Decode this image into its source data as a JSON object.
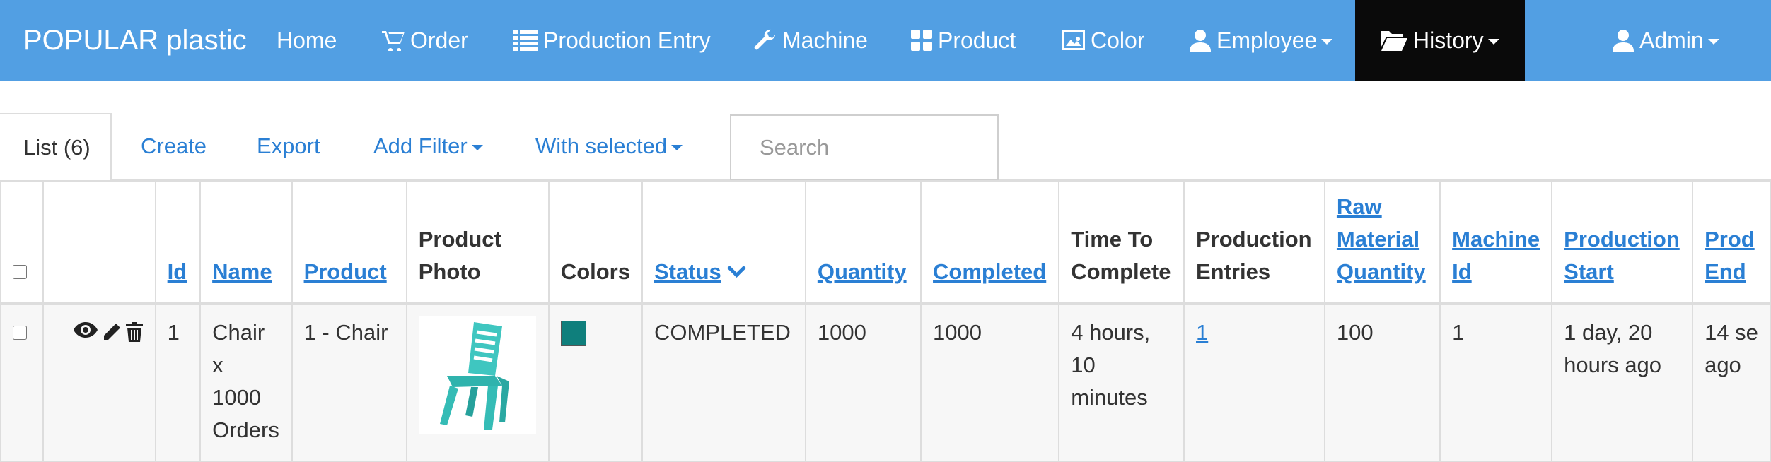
{
  "navbar": {
    "brand": "POPULAR plastic",
    "items": [
      {
        "label": "Home",
        "icon": ""
      },
      {
        "label": "Order",
        "icon": "cart-icon"
      },
      {
        "label": "Production Entry",
        "icon": "list-icon"
      },
      {
        "label": "Machine",
        "icon": "wrench-icon"
      },
      {
        "label": "Product",
        "icon": "grid-icon"
      },
      {
        "label": "Color",
        "icon": "picture-icon"
      },
      {
        "label": "Employee",
        "icon": "user-icon"
      },
      {
        "label": "History",
        "icon": "folder-open-icon"
      },
      {
        "label": "Admin",
        "icon": "user-icon"
      }
    ],
    "active_item": "History",
    "colors": {
      "bar": "#529fe3",
      "active": "#0a0a0a"
    }
  },
  "toolbar": {
    "list_label": "List (6)",
    "create_label": "Create",
    "export_label": "Export",
    "add_filter_label": "Add Filter",
    "with_selected_label": "With selected",
    "search_placeholder": "Search"
  },
  "table": {
    "headers": {
      "id": "Id",
      "name": "Name",
      "product": "Product",
      "product_photo": [
        "Product",
        "Photo"
      ],
      "colors": "Colors",
      "status": "Status",
      "quantity": "Quantity",
      "completed": "Completed",
      "time_to_complete": [
        "Time To",
        "Complete"
      ],
      "production_entries": [
        "Production",
        "Entries"
      ],
      "raw_material_quantity": [
        "Raw",
        "Material",
        "Quantity"
      ],
      "machine_id": [
        "Machine",
        "Id"
      ],
      "production_start": [
        "Production",
        "Start"
      ],
      "production_end": [
        "Prod",
        "End"
      ]
    },
    "rows": [
      {
        "id": "1",
        "name": [
          "Chair x",
          "1000",
          "Orders"
        ],
        "product": "1 - Chair",
        "color_swatch": "#0f7f7c",
        "status": "COMPLETED",
        "quantity": "1000",
        "completed": "1000",
        "time_to_complete": [
          "4 hours,",
          "10",
          "minutes"
        ],
        "production_entries": "1",
        "raw_material_quantity": "100",
        "machine_id": "1",
        "production_start": [
          "1 day, 20",
          "hours ago"
        ],
        "production_end": [
          "14 se",
          "ago"
        ]
      }
    ]
  }
}
